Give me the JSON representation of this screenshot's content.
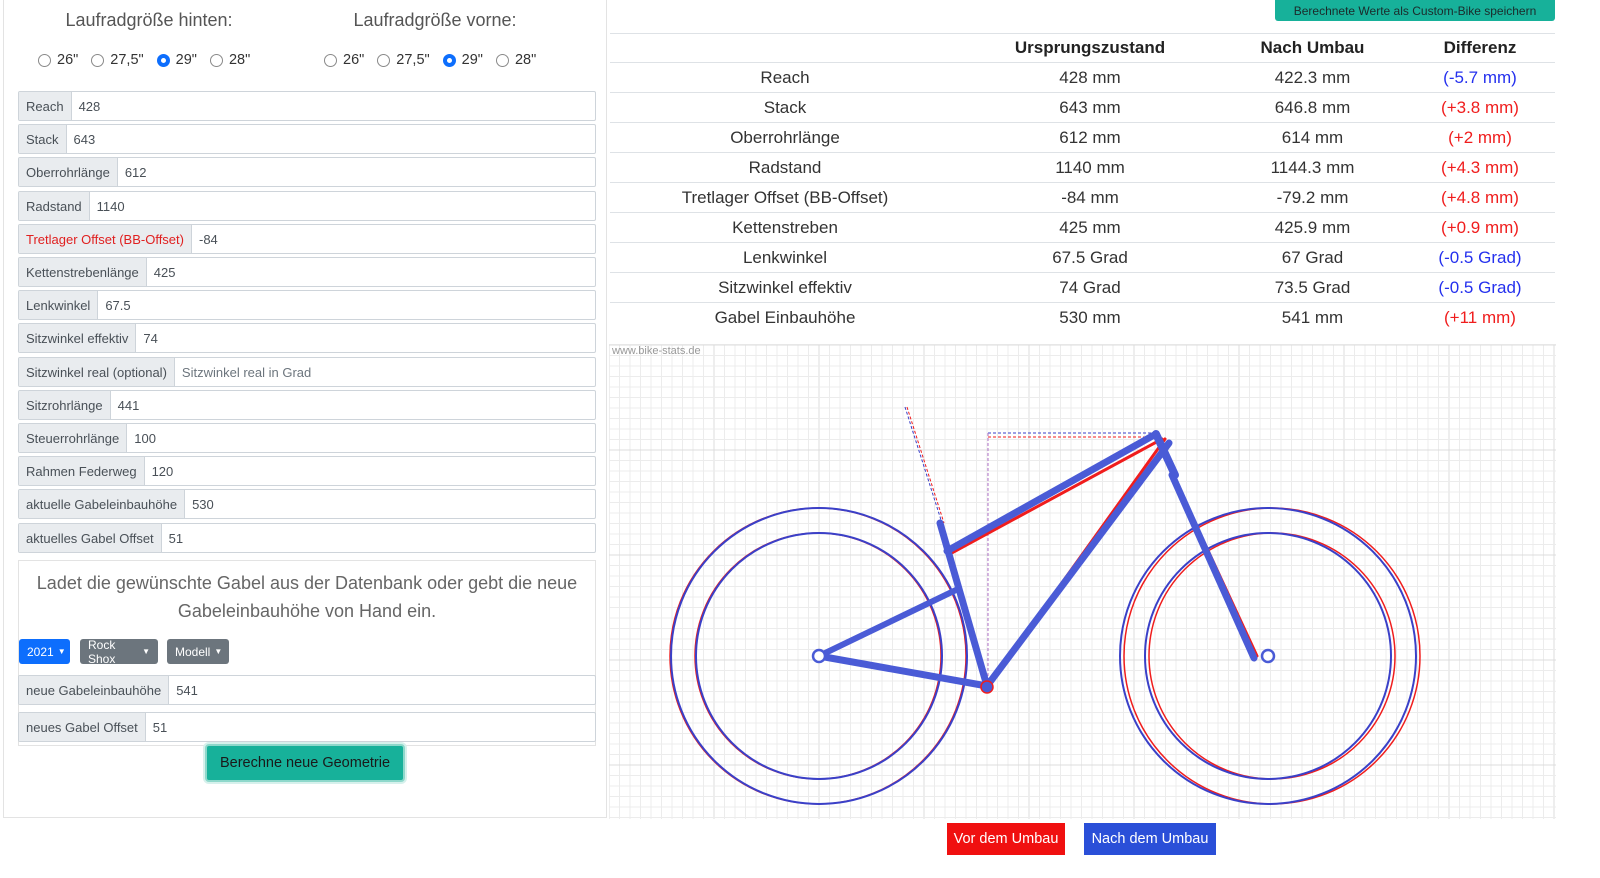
{
  "wheel_size": {
    "rear": {
      "title": "Laufradgröße hinten:",
      "options": [
        "26\"",
        "27,5\"",
        "29\"",
        "28\""
      ],
      "selected": "29\""
    },
    "front": {
      "title": "Laufradgröße vorne:",
      "options": [
        "26\"",
        "27,5\"",
        "29\"",
        "28\""
      ],
      "selected": "29\""
    }
  },
  "fields": [
    {
      "label": "Reach",
      "value": "428"
    },
    {
      "label": "Stack",
      "value": "643"
    },
    {
      "label": "Oberrohrlänge",
      "value": "612"
    },
    {
      "label": "Radstand",
      "value": "1140"
    },
    {
      "label": "Tretlager Offset (BB-Offset)",
      "value": "-84",
      "warn": true
    },
    {
      "label": "Kettenstrebenlänge",
      "value": "425"
    },
    {
      "label": "Lenkwinkel",
      "value": "67.5"
    },
    {
      "label": "Sitzwinkel effektiv",
      "value": "74"
    },
    {
      "label": "Sitzwinkel real (optional)",
      "placeholder": "Sitzwinkel real in Grad"
    },
    {
      "label": "Sitzrohrlänge",
      "value": "441"
    },
    {
      "label": "Steuerrohrlänge",
      "value": "100"
    },
    {
      "label": "Rahmen Federweg",
      "value": "120"
    },
    {
      "label": "aktuelle Gabeleinbauhöhe",
      "value": "530"
    },
    {
      "label": "aktuelles Gabel Offset",
      "value": "51"
    }
  ],
  "gabel": {
    "info_line1": "Ladet die gewünschte Gabel aus der Datenbank oder gebt die neue",
    "info_line2": "Gabeleinbauhöhe von Hand ein.",
    "year_dropdown": "2021",
    "brand_dropdown": "Rock Shox",
    "model_dropdown": "Modell",
    "new_fields": [
      {
        "label": "neue Gabeleinbauhöhe",
        "value": "541"
      },
      {
        "label": "neues Gabel Offset",
        "value": "51"
      }
    ]
  },
  "calc_button": "Berechne neue Geometrie",
  "save_button": "Berechnete Werte als Custom-Bike speichern",
  "results": {
    "headers": [
      "",
      "Ursprungszustand",
      "Nach Umbau",
      "Differenz"
    ],
    "rows": [
      {
        "name": "Reach",
        "orig": "428 mm",
        "new": "422.3 mm",
        "diff": "(-5.7 mm)",
        "sign": "neg"
      },
      {
        "name": "Stack",
        "orig": "643 mm",
        "new": "646.8 mm",
        "diff": "(+3.8 mm)",
        "sign": "pos"
      },
      {
        "name": "Oberrohrlänge",
        "orig": "612 mm",
        "new": "614 mm",
        "diff": "(+2 mm)",
        "sign": "pos"
      },
      {
        "name": "Radstand",
        "orig": "1140 mm",
        "new": "1144.3 mm",
        "diff": "(+4.3 mm)",
        "sign": "pos"
      },
      {
        "name": "Tretlager Offset (BB-Offset)",
        "orig": "-84 mm",
        "new": "-79.2 mm",
        "diff": "(+4.8 mm)",
        "sign": "pos"
      },
      {
        "name": "Kettenstreben",
        "orig": "425 mm",
        "new": "425.9 mm",
        "diff": "(+0.9 mm)",
        "sign": "pos"
      },
      {
        "name": "Lenkwinkel",
        "orig": "67.5 Grad",
        "new": "67 Grad",
        "diff": "(-0.5 Grad)",
        "sign": "neg"
      },
      {
        "name": "Sitzwinkel effektiv",
        "orig": "74 Grad",
        "new": "73.5 Grad",
        "diff": "(-0.5 Grad)",
        "sign": "neg"
      },
      {
        "name": "Gabel Einbauhöhe",
        "orig": "530 mm",
        "new": "541 mm",
        "diff": "(+11 mm)",
        "sign": "pos"
      }
    ]
  },
  "watermark": "www.bike-stats.de",
  "legend": {
    "before": "Vor dem Umbau",
    "after": "Nach dem Umbau"
  },
  "colors": {
    "before": "#f01d1d",
    "after": "#2430ee",
    "frame_after": "#4a5bd6",
    "teal": "#17b19a",
    "primary": "#0d6efd",
    "secondary": "#6c757d"
  }
}
